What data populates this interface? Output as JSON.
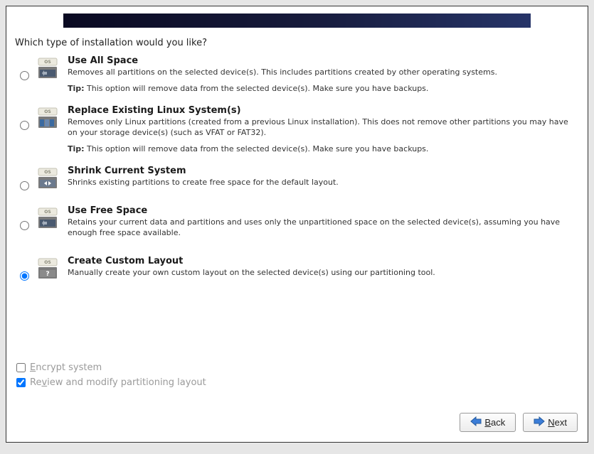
{
  "prompt": "Which type of installation would you like?",
  "options": [
    {
      "title": "Use All Space",
      "desc": "Removes all partitions on the selected device(s).  This includes partitions created by other operating systems.",
      "tip_label": "Tip:",
      "tip": " This option will remove data from the selected device(s).  Make sure you have backups.",
      "selected": false,
      "icon": "use-all"
    },
    {
      "title": "Replace Existing Linux System(s)",
      "desc": "Removes only Linux partitions (created from a previous Linux installation).  This does not remove other partitions you may have on your storage device(s) (such as VFAT or FAT32).",
      "tip_label": "Tip:",
      "tip": " This option will remove data from the selected device(s).  Make sure you have backups.",
      "selected": false,
      "icon": "replace"
    },
    {
      "title": "Shrink Current System",
      "desc": "Shrinks existing partitions to create free space for the default layout.",
      "tip_label": "",
      "tip": "",
      "selected": false,
      "icon": "shrink"
    },
    {
      "title": "Use Free Space",
      "desc": "Retains your current data and partitions and uses only the unpartitioned space on the selected device(s), assuming you have enough free space available.",
      "tip_label": "",
      "tip": "",
      "selected": false,
      "icon": "free-space"
    },
    {
      "title": "Create Custom Layout",
      "desc": "Manually create your own custom layout on the selected device(s) using our partitioning tool.",
      "tip_label": "",
      "tip": "",
      "selected": true,
      "icon": "custom"
    }
  ],
  "checkboxes": {
    "encrypt": {
      "label_pre": "E",
      "label_rest": "ncrypt system",
      "checked": false
    },
    "review": {
      "label_pre": "Re",
      "label_u": "v",
      "label_rest": "iew and modify partitioning layout",
      "checked": true
    }
  },
  "buttons": {
    "back": {
      "u": "B",
      "rest": "ack"
    },
    "next": {
      "u": "N",
      "rest": "ext"
    }
  }
}
